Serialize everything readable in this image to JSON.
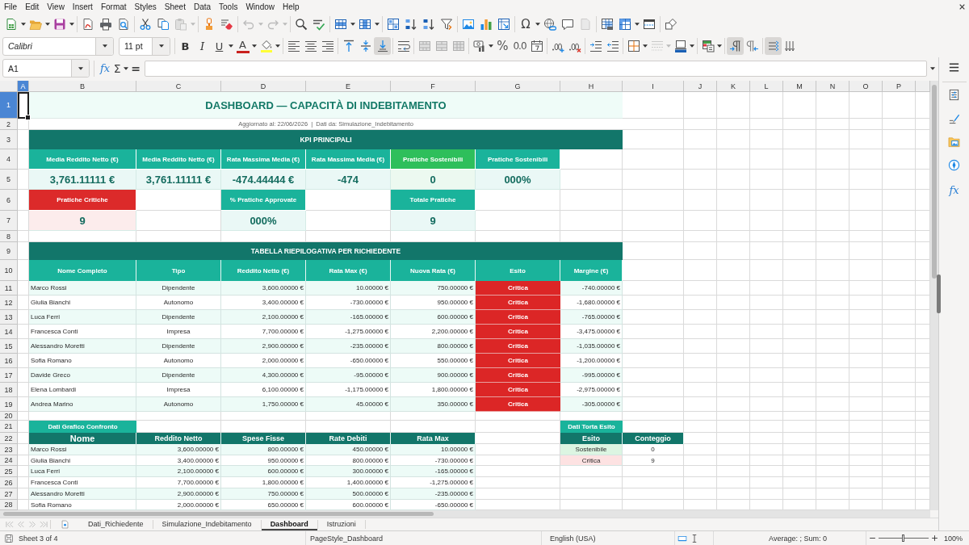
{
  "menu_bar": [
    "File",
    "Edit",
    "View",
    "Insert",
    "Format",
    "Styles",
    "Sheet",
    "Data",
    "Tools",
    "Window",
    "Help"
  ],
  "standard_toolbar": {
    "special_character": "Ω"
  },
  "formatting_toolbar": {
    "font_name": "Calibri",
    "font_size": "11 pt",
    "bold": {
      "glyph": "B",
      "on": false
    },
    "italic": {
      "glyph": "I",
      "on": false
    },
    "underline": {
      "glyph": "U",
      "on": false
    },
    "font_color": "A",
    "align_top": {
      "on": false
    },
    "align_middle": {
      "on": false
    },
    "align_bottom": {
      "on": true
    },
    "percent": "%",
    "number_format": "0.0",
    "left_to_right": {
      "on": true
    },
    "right_to_left": {
      "on": false
    },
    "text_horizontal": {
      "on": true
    },
    "text_vertical": {
      "on": false
    }
  },
  "formula_bar": {
    "cell_reference": "A1",
    "function_wizard": "fx",
    "sum": "Σ",
    "equals": "="
  },
  "sidebar": {
    "functions": "fx"
  },
  "sheet": {
    "columns": [
      {
        "label": "A",
        "selected": true
      },
      {
        "label": "B",
        "selected": false
      },
      {
        "label": "C",
        "selected": false
      },
      {
        "label": "D",
        "selected": false
      },
      {
        "label": "E",
        "selected": false
      },
      {
        "label": "F",
        "selected": false
      },
      {
        "label": "G",
        "selected": false
      },
      {
        "label": "H",
        "selected": false
      },
      {
        "label": "I",
        "selected": false
      },
      {
        "label": "J",
        "selected": false
      },
      {
        "label": "K",
        "selected": false
      },
      {
        "label": "L",
        "selected": false
      },
      {
        "label": "M",
        "selected": false
      },
      {
        "label": "N",
        "selected": false
      },
      {
        "label": "O",
        "selected": false
      },
      {
        "label": "P",
        "selected": false
      }
    ],
    "rows": [
      {
        "label": "1",
        "selected": true
      },
      {
        "label": "2",
        "selected": false
      },
      {
        "label": "3",
        "selected": false
      },
      {
        "label": "4",
        "selected": false
      },
      {
        "label": "5",
        "selected": false
      },
      {
        "label": "6",
        "selected": false
      },
      {
        "label": "7",
        "selected": false
      },
      {
        "label": "8",
        "selected": false
      },
      {
        "label": "9",
        "selected": false
      },
      {
        "label": "10",
        "selected": false
      },
      {
        "label": "11",
        "selected": false
      },
      {
        "label": "12",
        "selected": false
      },
      {
        "label": "13",
        "selected": false
      },
      {
        "label": "14",
        "selected": false
      },
      {
        "label": "15",
        "selected": false
      },
      {
        "label": "16",
        "selected": false
      },
      {
        "label": "17",
        "selected": false
      },
      {
        "label": "18",
        "selected": false
      },
      {
        "label": "19",
        "selected": false
      },
      {
        "label": "20",
        "selected": false
      },
      {
        "label": "21",
        "selected": false
      },
      {
        "label": "22",
        "selected": false
      },
      {
        "label": "23",
        "selected": false
      },
      {
        "label": "24",
        "selected": false
      },
      {
        "label": "25",
        "selected": false
      },
      {
        "label": "26",
        "selected": false
      },
      {
        "label": "27",
        "selected": false
      },
      {
        "label": "28",
        "selected": false
      }
    ],
    "title": "DASHBOARD — CAPACITÀ DI INDEBITAMENTO",
    "subtitle": "Aggiornato al: 22/06/2026  |  Dati da: Simulazione_Indebitamento",
    "kpi": {
      "heading": "KPI PRINCIPALI",
      "rows": [
        {
          "cards": [
            {
              "label": "Media Reddito Netto (€)",
              "value": "3,761.11111 €",
              "color": "#1ab39b"
            },
            {
              "label": "Media Reddito Netto (€)",
              "value": "3,761.11111 €",
              "color": "#1ab39b"
            },
            {
              "label": "Rata Massima Media (€)",
              "value": "-474.44444 €",
              "color": "#1ab39b"
            },
            {
              "label": "Rata Massima Media (€)",
              "value": "-474",
              "color": "#1ab39b"
            },
            {
              "label": "Pratiche Sostenibili",
              "value": "0",
              "color": "#2ebf5b"
            },
            {
              "label": "Pratiche Sostenibili",
              "value": "000%",
              "color": "#1ab39b"
            }
          ]
        },
        {
          "cards": [
            {
              "label": "Pratiche Critiche",
              "value": "9",
              "color": "#dc2a2a"
            },
            {
              "label": "% Pratiche Approvate",
              "value": "000%",
              "color": "#1ab39b"
            },
            {
              "label": "Totale Pratiche",
              "value": "9",
              "color": "#1ab39b"
            }
          ]
        }
      ]
    },
    "summary_table": {
      "heading": "TABELLA RIEPILOGATIVA PER RICHIEDENTE",
      "columns": [
        "Nome Completo",
        "Tipo",
        "Reddito Netto (€)",
        "Rata Max (€)",
        "Nuova Rata (€)",
        "Esito",
        "Margine (€)"
      ],
      "rows": [
        {
          "name": "Marco Rossi",
          "type": "Dipendente",
          "net_income": "3,600.00000 €",
          "max_installment": "10.00000 €",
          "new_installment": "750.00000 €",
          "outcome": {
            "label": "Critica",
            "critical": true
          },
          "margin": "-740.00000 €"
        },
        {
          "name": "Giulia Bianchi",
          "type": "Autonomo",
          "net_income": "3,400.00000 €",
          "max_installment": "-730.00000 €",
          "new_installment": "950.00000 €",
          "outcome": {
            "label": "Critica",
            "critical": true
          },
          "margin": "-1,680.00000 €"
        },
        {
          "name": "Luca Ferri",
          "type": "Dipendente",
          "net_income": "2,100.00000 €",
          "max_installment": "-165.00000 €",
          "new_installment": "600.00000 €",
          "outcome": {
            "label": "Critica",
            "critical": true
          },
          "margin": "-765.00000 €"
        },
        {
          "name": "Francesca Conti",
          "type": "Impresa",
          "net_income": "7,700.00000 €",
          "max_installment": "-1,275.00000 €",
          "new_installment": "2,200.00000 €",
          "outcome": {
            "label": "Critica",
            "critical": true
          },
          "margin": "-3,475.00000 €"
        },
        {
          "name": "Alessandro Moretti",
          "type": "Dipendente",
          "net_income": "2,900.00000 €",
          "max_installment": "-235.00000 €",
          "new_installment": "800.00000 €",
          "outcome": {
            "label": "Critica",
            "critical": true
          },
          "margin": "-1,035.00000 €"
        },
        {
          "name": "Sofia Romano",
          "type": "Autonomo",
          "net_income": "2,000.00000 €",
          "max_installment": "-650.00000 €",
          "new_installment": "550.00000 €",
          "outcome": {
            "label": "Critica",
            "critical": true
          },
          "margin": "-1,200.00000 €"
        },
        {
          "name": "Davide Greco",
          "type": "Dipendente",
          "net_income": "4,300.00000 €",
          "max_installment": "-95.00000 €",
          "new_installment": "900.00000 €",
          "outcome": {
            "label": "Critica",
            "critical": true
          },
          "margin": "-995.00000 €"
        },
        {
          "name": "Elena Lombardi",
          "type": "Impresa",
          "net_income": "6,100.00000 €",
          "max_installment": "-1,175.00000 €",
          "new_installment": "1,800.00000 €",
          "outcome": {
            "label": "Critica",
            "critical": true
          },
          "margin": "-2,975.00000 €"
        },
        {
          "name": "Andrea Marino",
          "type": "Autonomo",
          "net_income": "1,750.00000 €",
          "max_installment": "45.00000 €",
          "new_installment": "350.00000 €",
          "outcome": {
            "label": "Critica",
            "critical": true
          },
          "margin": "-305.00000 €"
        }
      ]
    },
    "comparison_data": {
      "label": "Dati Grafico Confronto",
      "columns": [
        "Nome",
        "Reddito Netto",
        "Spese Fisse",
        "Rate Debiti",
        "Rata Max"
      ],
      "rows": [
        {
          "name": "Marco Rossi",
          "net_income": "3,600.00000 €",
          "fixed_expenses": "800.00000 €",
          "debt_payments": "450.00000 €",
          "max_installment": "10.00000 €"
        },
        {
          "name": "Giulia Bianchi",
          "net_income": "3,400.00000 €",
          "fixed_expenses": "950.00000 €",
          "debt_payments": "800.00000 €",
          "max_installment": "-730.00000 €"
        },
        {
          "name": "Luca Ferri",
          "net_income": "2,100.00000 €",
          "fixed_expenses": "600.00000 €",
          "debt_payments": "300.00000 €",
          "max_installment": "-165.00000 €"
        },
        {
          "name": "Francesca Conti",
          "net_income": "7,700.00000 €",
          "fixed_expenses": "1,800.00000 €",
          "debt_payments": "1,400.00000 €",
          "max_installment": "-1,275.00000 €"
        },
        {
          "name": "Alessandro Moretti",
          "net_income": "2,900.00000 €",
          "fixed_expenses": "750.00000 €",
          "debt_payments": "500.00000 €",
          "max_installment": "-235.00000 €"
        },
        {
          "name": "Sofia Romano",
          "net_income": "2,000.00000 €",
          "fixed_expenses": "650.00000 €",
          "debt_payments": "600.00000 €",
          "max_installment": "-650.00000 €"
        }
      ]
    },
    "outcome_data": {
      "label": "Dati Torta Esito",
      "columns": [
        "Esito",
        "Conteggio"
      ],
      "rows": [
        {
          "label": "Sostenibile",
          "count": "0",
          "color": "#dcf5e2"
        },
        {
          "label": "Critica",
          "count": "9",
          "color": "#fde2e2"
        }
      ]
    }
  },
  "sheet_tabs": [
    {
      "label": "Dati_Richiedente",
      "selected": false
    },
    {
      "label": "Simulazione_Indebitamento",
      "selected": false
    },
    {
      "label": "Dashboard",
      "selected": true
    },
    {
      "label": "Istruzioni",
      "selected": false
    }
  ],
  "status_bar": {
    "sheet": "Sheet 3 of 4",
    "page_style": "PageStyle_Dashboard",
    "language": "English (USA)",
    "selection_summary": "Average: ; Sum: 0",
    "zoom": {
      "level": 0.5,
      "percent": "100%"
    }
  }
}
